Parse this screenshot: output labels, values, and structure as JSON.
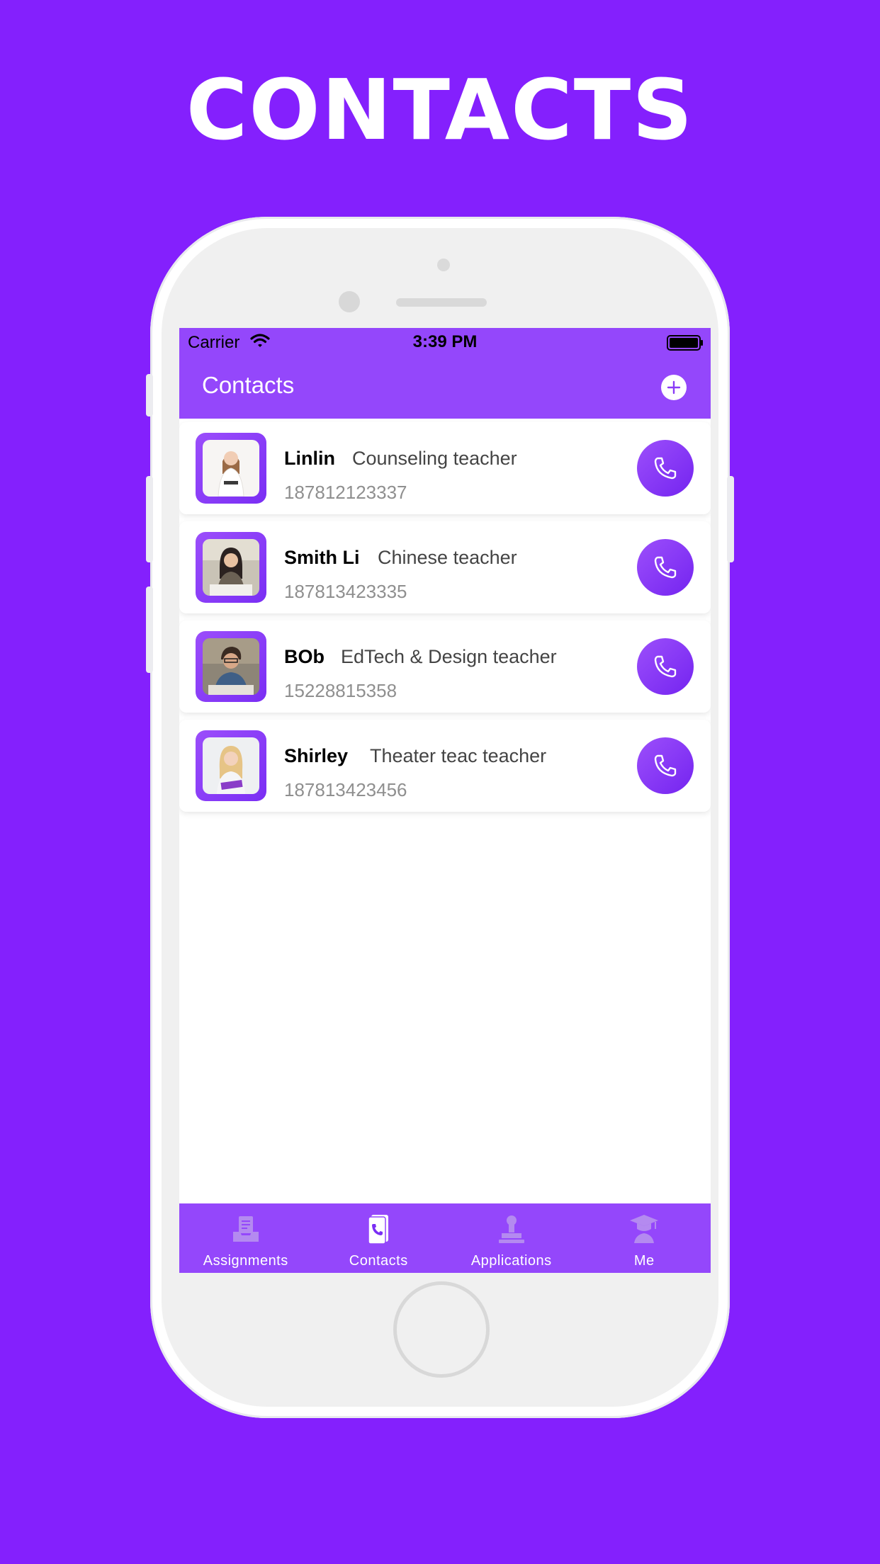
{
  "headline": "CONTACTS",
  "status_bar": {
    "carrier": "Carrier",
    "time": "3:39 PM"
  },
  "nav": {
    "title": "Contacts",
    "add_icon": "plus-circle-icon"
  },
  "contacts": [
    {
      "name": "Linlin",
      "role": "Counseling teacher",
      "phone": "187812123337"
    },
    {
      "name": "Smith Li",
      "role": "Chinese teacher",
      "phone": "187813423335"
    },
    {
      "name": "BOb",
      "role": "EdTech & Design teacher",
      "phone": "15228815358"
    },
    {
      "name": "Shirley",
      "role": "Theater teac teacher",
      "phone": "187813423456"
    }
  ],
  "tabs": [
    {
      "label": "Assignments",
      "icon": "inbox-icon",
      "active": false
    },
    {
      "label": "Contacts",
      "icon": "phone-book-icon",
      "active": true
    },
    {
      "label": "Applications",
      "icon": "stamp-icon",
      "active": false
    },
    {
      "label": "Me",
      "icon": "graduate-icon",
      "active": false
    }
  ],
  "colors": {
    "background": "#8420fd",
    "bar": "#9447fb",
    "accent": "#7424f0",
    "inactive_tab_icon": "#b48af0"
  }
}
